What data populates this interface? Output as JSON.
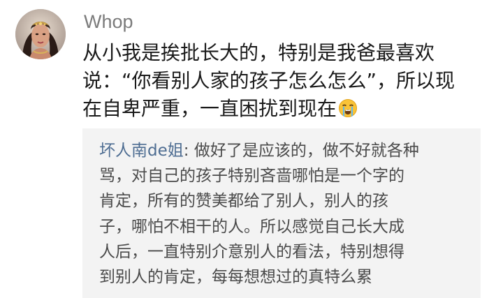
{
  "post": {
    "avatar_icon": "user-avatar-photo",
    "username": "Whop",
    "comment_lines": [
      "从小我是挨批长大的，特别是我爸最喜欢",
      "说：“你看别人家的孩子怎么怎么”，所以现",
      "在自卑严重，一直困扰到现在"
    ],
    "emoji_icon": "loudly-crying-face-emoji"
  },
  "reply": {
    "author": "坏人南de姐",
    "separator": ": ",
    "lines": [
      "做好了是应该的，做不好就各种",
      "骂，对自己的孩子特别吝啬哪怕是一个字的",
      "肯定，所有的赞美都给了别人，别人的孩",
      "子，哪怕不相干的人。所以感觉自己长大成",
      "人后，一直特别介意别人的看法，特别想得",
      "到别人的肯定，每每想想过的真特么累"
    ]
  },
  "colors": {
    "background": "#ffffff",
    "username": "#7b7b7b",
    "comment_text": "#1a1a1a",
    "reply_background": "#f3f3f3",
    "reply_author": "#4e6d92",
    "reply_text": "#4a4a4a"
  }
}
